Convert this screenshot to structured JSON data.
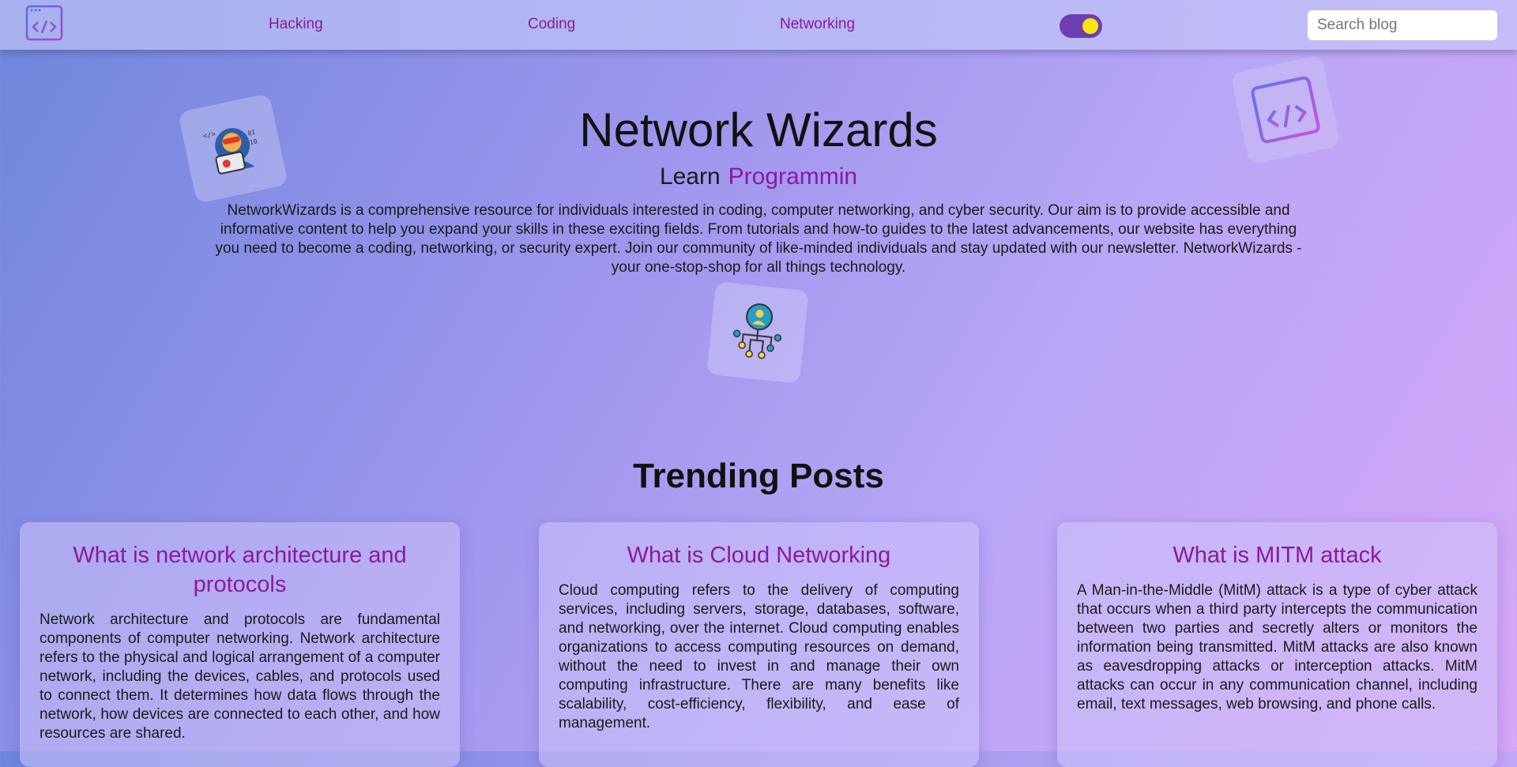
{
  "nav": {
    "logo_icon": "code-window-icon",
    "links": [
      "Hacking",
      "Coding",
      "Networking"
    ],
    "theme_toggle": "on",
    "search_placeholder": "Search blog"
  },
  "hero": {
    "title": "Network Wizards",
    "learn_label": "Learn",
    "typed_text": "Programmin",
    "description": "NetworkWizards is a comprehensive resource for individuals interested in coding, computer networking, and cyber security. Our aim is to provide accessible and informative content to help you expand your skills in these exciting fields. From tutorials and how-to guides to the latest advancements, our website has everything you need to become a coding, networking, or security expert. Join our community of like-minded individuals and stay updated with our newsletter. NetworkWizards - your one-stop-shop for all things technology.",
    "illustrations": [
      "hacker-icon",
      "code-window-icon",
      "network-user-icon"
    ]
  },
  "trending": {
    "heading": "Trending Posts",
    "posts": [
      {
        "title": "What is network architecture and protocols",
        "excerpt": "Network architecture and protocols are fundamental components of computer networking. Network architecture refers to the physical and logical arrangement of a computer network, including the devices, cables, and protocols used to connect them. It determines how data flows through the network, how devices are connected to each other, and how resources are shared."
      },
      {
        "title": "What is Cloud Networking",
        "excerpt": "Cloud computing refers to the delivery of computing services, including servers, storage, databases, software, and networking, over the internet. Cloud computing enables organizations to access computing resources on demand, without the need to invest in and manage their own computing infrastructure. There are many benefits like scalability, cost-efficiency, flexibility, and ease of management."
      },
      {
        "title": "What is MITM attack",
        "excerpt": "A Man-in-the-Middle (MitM) attack is a type of cyber attack that occurs when a third party intercepts the communication between two parties and secretly alters or monitors the information being transmitted. MitM attacks are also known as eavesdropping attacks or interception attacks. MitM attacks can occur in any communication channel, including email, text messages, web browsing, and phone calls."
      }
    ]
  },
  "colors": {
    "accent": "#8a1a9e",
    "toggle_track": "#6c3fb0",
    "toggle_knob": "#f7e510"
  }
}
